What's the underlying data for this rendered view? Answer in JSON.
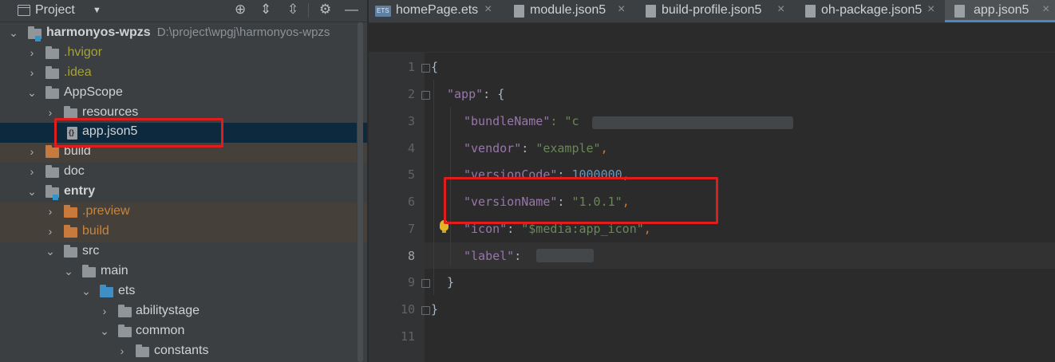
{
  "project_panel": {
    "title": "Project",
    "tree": [
      {
        "label": "harmonyos-wpzs",
        "path": "D:\\project\\wpgj\\harmonyos-wpzs"
      },
      {
        "label": ".hvigor"
      },
      {
        "label": ".idea"
      },
      {
        "label": "AppScope"
      },
      {
        "label": "resources"
      },
      {
        "label": "app.json5"
      },
      {
        "label": "build"
      },
      {
        "label": "doc"
      },
      {
        "label": "entry"
      },
      {
        "label": ".preview"
      },
      {
        "label": "build"
      },
      {
        "label": "src"
      },
      {
        "label": "main"
      },
      {
        "label": "ets"
      },
      {
        "label": "abilitystage"
      },
      {
        "label": "common"
      },
      {
        "label": "constants"
      }
    ]
  },
  "tabs": [
    {
      "label": "homePage.ets",
      "icon": "ets-file-icon",
      "active": false
    },
    {
      "label": "module.json5",
      "icon": "json-file-icon",
      "active": false
    },
    {
      "label": "build-profile.json5",
      "icon": "json-file-icon",
      "active": false
    },
    {
      "label": "oh-package.json5",
      "icon": "json-file-icon",
      "active": false
    },
    {
      "label": "app.json5",
      "icon": "json-file-icon",
      "active": true
    }
  ],
  "editor": {
    "line_numbers": [
      "1",
      "2",
      "3",
      "4",
      "5",
      "6",
      "7",
      "8",
      "9",
      "10",
      "11"
    ],
    "current_line": "8",
    "lines": {
      "l1": "{",
      "l2_key": "\"app\"",
      "l2_rest": ": {",
      "l3_key": "\"bundleName\"",
      "l3_rest": ": \"c",
      "l4_key": "\"vendor\"",
      "l4_val": "\"example\"",
      "l5_key": "\"versionCode\"",
      "l5_val": "1000000",
      "l6_key": "\"versionName\"",
      "l6_val": "\"1.0.1\"",
      "l7_key": "\"icon\"",
      "l7_val": "\"$media:app_icon\"",
      "l8_key": "\"label\"",
      "l8_rest": ":",
      "l9": "}",
      "l10": "}"
    }
  },
  "colors": {
    "highlight_box": "#e01d1d",
    "active_tab_underline": "#4a88c7"
  }
}
